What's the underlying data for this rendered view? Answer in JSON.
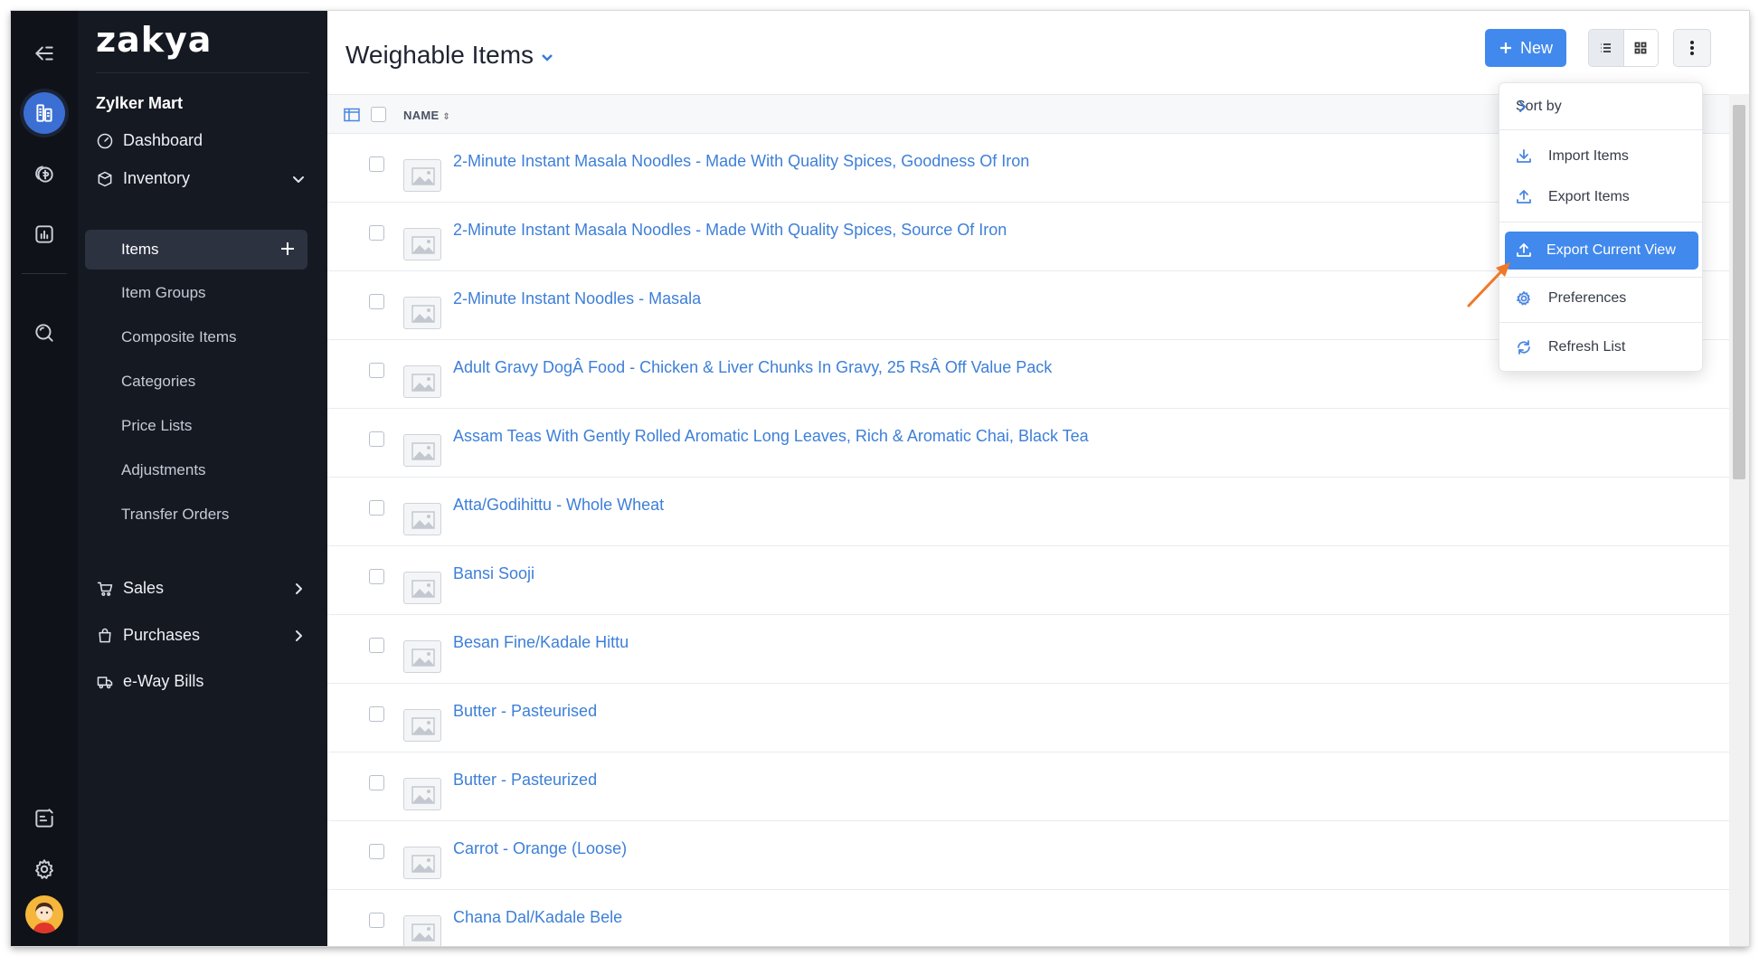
{
  "app": {
    "logo": "zakya",
    "org_name": "Zylker Mart"
  },
  "rail": {
    "icons": [
      "collapse-icon",
      "organization-icon",
      "money-icon",
      "reports-icon",
      "search-icon",
      "checklist-icon",
      "gear-icon",
      "avatar"
    ]
  },
  "sidebar": {
    "dashboard": "Dashboard",
    "inventory": "Inventory",
    "items": "Items",
    "item_groups": "Item Groups",
    "composite_items": "Composite Items",
    "categories": "Categories",
    "price_lists": "Price Lists",
    "adjustments": "Adjustments",
    "transfer_orders": "Transfer Orders",
    "sales": "Sales",
    "purchases": "Purchases",
    "eway_bills": "e-Way Bills"
  },
  "header": {
    "title": "Weighable Items",
    "new_button": "New"
  },
  "table": {
    "name_header": "NAME",
    "rows": [
      "2-Minute Instant Masala Noodles - Made With Quality Spices, Goodness Of Iron",
      "2-Minute Instant Masala Noodles - Made With Quality Spices, Source Of Iron",
      "2-Minute Instant Noodles - Masala",
      "Adult Gravy DogÂ Food - Chicken & Liver Chunks In Gravy, 25 RsÂ Off Value Pack",
      "Assam Teas With Gently Rolled Aromatic Long Leaves, Rich & Aromatic Chai, Black Tea",
      "Atta/Godihittu - Whole Wheat",
      "Bansi Sooji",
      "Besan Fine/Kadale Hittu",
      "Butter - Pasteurised",
      "Butter - Pasteurized",
      "Carrot - Orange (Loose)",
      "Chana Dal/Kadale Bele"
    ]
  },
  "menu": {
    "sort_by": "Sort by",
    "import_items": "Import Items",
    "export_items": "Export Items",
    "export_current_view": "Export Current View",
    "preferences": "Preferences",
    "refresh_list": "Refresh List"
  },
  "colors": {
    "accent": "#4189ed",
    "link": "#3d7fd8",
    "sidebar_bg": "#151922",
    "pointer": "#f0782a"
  }
}
